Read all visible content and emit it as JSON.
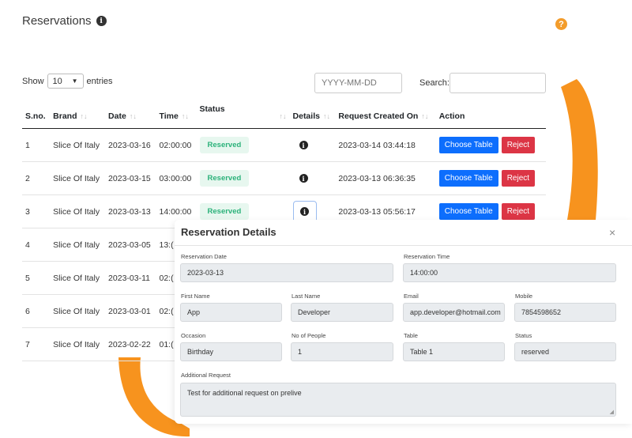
{
  "header": {
    "title": "Reservations",
    "info_glyph": "i",
    "help_glyph": "?"
  },
  "controls": {
    "show_label": "Show",
    "entries_value": "10",
    "entries_label": "entries",
    "date_placeholder": "YYYY-MM-DD",
    "search_label": "Search:"
  },
  "table": {
    "columns": [
      "S.no.",
      "Brand",
      "Date",
      "Time",
      "Status",
      "Details",
      "Request Created On",
      "Action"
    ],
    "rows": [
      {
        "sno": "1",
        "brand": "Slice Of Italy",
        "date": "2023-03-16",
        "time": "02:00:00",
        "status": "Reserved",
        "created": "2023-03-14 03:44:18"
      },
      {
        "sno": "2",
        "brand": "Slice Of Italy",
        "date": "2023-03-15",
        "time": "03:00:00",
        "status": "Reserved",
        "created": "2023-03-13 06:36:35"
      },
      {
        "sno": "3",
        "brand": "Slice Of Italy",
        "date": "2023-03-13",
        "time": "14:00:00",
        "status": "Reserved",
        "created": "2023-03-13 05:56:17"
      },
      {
        "sno": "4",
        "brand": "Slice Of Italy",
        "date": "2023-03-05",
        "time": "13:("
      },
      {
        "sno": "5",
        "brand": "Slice Of Italy",
        "date": "2023-03-11",
        "time": "02:("
      },
      {
        "sno": "6",
        "brand": "Slice Of Italy",
        "date": "2023-03-01",
        "time": "02:("
      },
      {
        "sno": "7",
        "brand": "Slice Of Italy",
        "date": "2023-02-22",
        "time": "01:("
      }
    ],
    "choose_label": "Choose Table",
    "reject_label": "Reject"
  },
  "modal": {
    "title": "Reservation Details",
    "close_glyph": "×",
    "fields": {
      "reservation_date": {
        "label": "Reservation Date",
        "value": "2023-03-13"
      },
      "reservation_time": {
        "label": "Reservation Time",
        "value": "14:00:00"
      },
      "first_name": {
        "label": "First Name",
        "value": "App"
      },
      "last_name": {
        "label": "Last Name",
        "value": "Developer"
      },
      "email": {
        "label": "Email",
        "value": "app.developer@hotmail.com"
      },
      "mobile": {
        "label": "Mobile",
        "value": "7854598652"
      },
      "occasion": {
        "label": "Occasion",
        "value": "Birthday"
      },
      "people": {
        "label": "No of People",
        "value": "1"
      },
      "table": {
        "label": "Table",
        "value": "Table 1"
      },
      "status": {
        "label": "Status",
        "value": "reserved"
      },
      "additional": {
        "label": "Additional Request",
        "value": "Test for additional request on prelive"
      }
    }
  },
  "colors": {
    "accent_orange": "#f7931e",
    "primary_blue": "#0d6efd",
    "danger_red": "#dc3545",
    "success_green": "#2bb27a"
  }
}
